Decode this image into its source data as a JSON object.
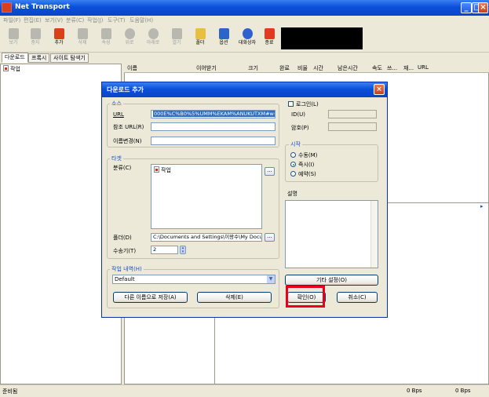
{
  "window": {
    "title": "Net Transport",
    "min_glyph": "_",
    "max_glyph": "□",
    "close_glyph": "×"
  },
  "menu": [
    "파일(F)",
    "편집(E)",
    "보기(V)",
    "분류(C)",
    "작업(J)",
    "도구(T)",
    "도움말(H)"
  ],
  "toolbar": [
    {
      "label": "보기",
      "icon": "open-icon",
      "enabled": false
    },
    {
      "label": "중지",
      "icon": "stop-icon",
      "enabled": false
    },
    {
      "label": "추가",
      "icon": "add-icon",
      "enabled": true
    },
    {
      "label": "삭제",
      "icon": "delete-icon",
      "enabled": false
    },
    {
      "label": "속성",
      "icon": "properties-icon",
      "enabled": false
    },
    {
      "label": "위로",
      "icon": "move-up-icon",
      "enabled": false
    },
    {
      "label": "아래로",
      "icon": "move-down-icon",
      "enabled": false
    },
    {
      "label": "열기",
      "icon": "open-file-icon",
      "enabled": false
    },
    {
      "label": "폴더",
      "icon": "folder-icon",
      "enabled": true
    },
    {
      "label": "옵션",
      "icon": "options-icon",
      "enabled": true
    },
    {
      "label": "대화상자",
      "icon": "help-icon",
      "enabled": true
    },
    {
      "label": "종료",
      "icon": "exit-icon",
      "enabled": true
    }
  ],
  "tabs": [
    "다운로드",
    "프록시",
    "사이트 탐색기"
  ],
  "tree": {
    "item": "작업"
  },
  "columns": [
    "이름",
    "이어받기",
    "크기",
    "완료",
    "비율",
    "시간",
    "남은시간",
    "속도",
    "쓰...",
    "재...",
    "URL"
  ],
  "status": {
    "left": "준비됨",
    "speed1": "0 Bps",
    "speed2": "0 Bps"
  },
  "dialog": {
    "title": "다운로드 추가",
    "close_glyph": "×",
    "source": {
      "group_label": "소스",
      "url_label": "URL",
      "url_value": "000E%C%B0%5%UMM%EKAM%ANUKUTXM#w=1",
      "referer_label": "참조 URL(R)",
      "referer_value": "",
      "rename_label": "이름변경(N)",
      "rename_value": ""
    },
    "login": {
      "label": "로그인(L)",
      "id_label": "ID(U)",
      "password_label": "암호(P)"
    },
    "start": {
      "group_label": "시작",
      "options": [
        {
          "label": "수동(M)",
          "selected": false
        },
        {
          "label": "즉시(I)",
          "selected": true
        },
        {
          "label": "예약(S)",
          "selected": false
        }
      ]
    },
    "target": {
      "group_label": "타겟",
      "category_label": "분류(C)",
      "category_item": "작업",
      "browse_glyph": "...",
      "folder_label": "폴더(D)",
      "folder_value": "C:\\Documents and Settings\\이왕수\\My Docum",
      "splits_label": "수송기(T)",
      "splits_value": "2"
    },
    "description_label": "설명",
    "history": {
      "group_label": "작업 내역(H)",
      "value": "Default"
    },
    "buttons": {
      "save_default": "다른 이름으로 저장(A)",
      "delete": "삭제(E)",
      "other_settings": "기타 설정(O)",
      "ok": "확인(O)",
      "cancel": "취소(C)"
    },
    "highlight_color": "#e8001c"
  }
}
